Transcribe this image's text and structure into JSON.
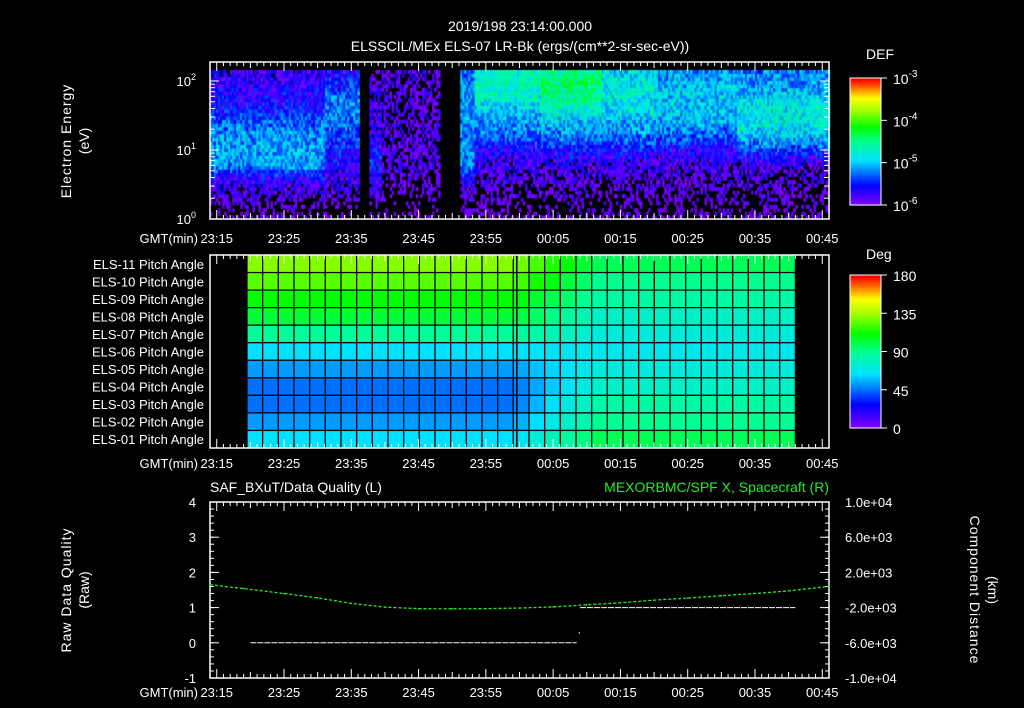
{
  "header": {
    "timestamp": "2019/198 23:14:00.000",
    "title": "ELSSCIL/MEx ELS-07 LR-Bk  (ergs/(cm**2-sr-sec-eV))"
  },
  "colors": {
    "background": "#000000",
    "axis": "#ffffff",
    "green_trace": "#22ee22",
    "quality_trace": "#ffffff"
  },
  "chart_data": [
    {
      "type": "heatmap",
      "name": "electron-spectrogram",
      "title": "ELSSCIL/MEx ELS-07 LR-Bk  (ergs/(cm**2-sr-sec-eV))",
      "ylabel": [
        "Electron Energy",
        "(eV)"
      ],
      "xlabel": "GMT(min)",
      "x_range_min": [
        0,
        92
      ],
      "x_origin": "23:14",
      "x_ticks": [
        "23:15",
        "23:25",
        "23:35",
        "23:45",
        "23:55",
        "00:05",
        "00:15",
        "00:25",
        "00:35",
        "00:45"
      ],
      "y_scale": "log",
      "y_range_log10": [
        0,
        2.275
      ],
      "y_ticks": [
        {
          "b": "10",
          "e": "2"
        },
        {
          "b": "10",
          "e": "1"
        },
        {
          "b": "10",
          "e": "0"
        }
      ],
      "colorbar": {
        "label": "DEF",
        "scale": "log",
        "range_log10": [
          -6,
          -3
        ],
        "ticks": [
          {
            "b": "10",
            "e": "-3"
          },
          {
            "b": "10",
            "e": "-4"
          },
          {
            "b": "10",
            "e": "-5"
          },
          {
            "b": "10",
            "e": "-6"
          }
        ]
      },
      "energy_bins_eV": [
        1.5,
        2.5,
        4,
        6,
        10,
        16,
        25,
        40,
        63,
        100,
        140
      ],
      "segments_log10_def": [
        {
          "t": [
            0,
            17
          ],
          "v": [
            -6.2,
            -5.9,
            -5.6,
            -5.0,
            -4.9,
            -5.0,
            -5.2,
            -5.5,
            -5.6,
            -5.7,
            -5.8
          ]
        },
        {
          "t": [
            17,
            22
          ],
          "v": [
            -6.3,
            -6.0,
            -5.8,
            -5.6,
            -5.5,
            -5.3,
            -5.1,
            -5.0,
            -5.1,
            -5.4,
            -5.6
          ]
        },
        {
          "t": [
            22,
            23.5
          ],
          "v": [
            -6.6,
            -6.6,
            -6.6,
            -6.6,
            -6.6,
            -6.6,
            -6.6,
            -6.6,
            -6.6,
            -6.6,
            -6.6
          ]
        },
        {
          "t": [
            23.5,
            25.5
          ],
          "v": [
            -6.2,
            -5.9,
            -5.7,
            -5.4,
            -5.6,
            -5.8,
            -5.8,
            -5.9,
            -5.9,
            -6.0,
            -6.0
          ]
        },
        {
          "t": [
            25.5,
            34
          ],
          "v": [
            -6.3,
            -6.2,
            -6.1,
            -6.0,
            -6.0,
            -6.0,
            -6.0,
            -6.0,
            -6.0,
            -6.0,
            -6.0
          ]
        },
        {
          "t": [
            34,
            37
          ],
          "v": [
            -6.6,
            -6.6,
            -6.6,
            -6.6,
            -6.6,
            -6.6,
            -6.6,
            -6.6,
            -6.6,
            -6.6,
            -6.6
          ]
        },
        {
          "t": [
            37,
            39
          ],
          "v": [
            -6.2,
            -6.0,
            -5.5,
            -5.0,
            -5.0,
            -5.1,
            -5.1,
            -5.0,
            -5.0,
            -5.1,
            -5.2
          ]
        },
        {
          "t": [
            39,
            49
          ],
          "v": [
            -6.2,
            -6.1,
            -5.9,
            -5.8,
            -5.6,
            -5.2,
            -5.0,
            -4.8,
            -4.5,
            -4.4,
            -4.5
          ]
        },
        {
          "t": [
            49,
            58
          ],
          "v": [
            -6.2,
            -6.1,
            -6.0,
            -5.8,
            -5.5,
            -5.1,
            -4.8,
            -4.5,
            -4.2,
            -4.1,
            -4.3
          ]
        },
        {
          "t": [
            58,
            66
          ],
          "v": [
            -6.2,
            -6.1,
            -6.0,
            -5.8,
            -5.5,
            -5.1,
            -4.9,
            -4.7,
            -4.6,
            -4.6,
            -4.8
          ]
        },
        {
          "t": [
            66,
            78
          ],
          "v": [
            -6.2,
            -6.1,
            -6.0,
            -5.8,
            -5.6,
            -5.2,
            -4.9,
            -4.8,
            -4.8,
            -4.9,
            -5.0
          ]
        },
        {
          "t": [
            78,
            92
          ],
          "v": [
            -6.2,
            -6.1,
            -6.0,
            -5.9,
            -5.3,
            -4.8,
            -4.6,
            -4.6,
            -4.8,
            -5.0,
            -5.1
          ]
        }
      ]
    },
    {
      "type": "heatmap",
      "name": "pitch-angle",
      "xlabel": "GMT(min)",
      "x_ticks": [
        "23:15",
        "23:25",
        "23:35",
        "23:45",
        "23:55",
        "00:05",
        "00:15",
        "00:25",
        "00:35",
        "00:45"
      ],
      "rows": [
        "ELS-11 Pitch Angle",
        "ELS-10 Pitch Angle",
        "ELS-09 Pitch Angle",
        "ELS-08 Pitch Angle",
        "ELS-07 Pitch Angle",
        "ELS-06 Pitch Angle",
        "ELS-05 Pitch Angle",
        "ELS-04 Pitch Angle",
        "ELS-03 Pitch Angle",
        "ELS-02 Pitch Angle",
        "ELS-01 Pitch Angle"
      ],
      "data_range_min": [
        5.5,
        87
      ],
      "columns": 35,
      "early_deg": [
        131,
        124,
        112,
        103,
        88,
        63,
        52,
        45,
        45,
        52,
        63
      ],
      "late_deg": [
        99,
        90,
        85,
        77,
        72,
        68,
        72,
        77,
        85,
        90,
        99
      ],
      "transition_min": [
        45,
        58
      ],
      "marker_min": 45.6,
      "colorbar": {
        "label": "Deg",
        "range": [
          0,
          180
        ],
        "ticks": [
          "180",
          "135",
          "90",
          "45",
          "0"
        ]
      }
    },
    {
      "type": "line",
      "name": "data-quality-and-position",
      "title_left": "SAF_BXuT/Data Quality (L)",
      "title_right": "MEXORBMC/SPF X, Spacecraft (R)",
      "ylabel_left": [
        "Raw Data Quality",
        "(Raw)"
      ],
      "ylabel_right": [
        "Component Distance",
        "(km)"
      ],
      "xlabel": "GMT(min)",
      "x_ticks": [
        "23:15",
        "23:25",
        "23:35",
        "23:45",
        "23:55",
        "00:05",
        "00:15",
        "00:25",
        "00:35",
        "00:45"
      ],
      "ylim_left": [
        -1,
        4
      ],
      "yticks_left": [
        "4",
        "3",
        "2",
        "1",
        "0",
        "-1"
      ],
      "ylim_right": [
        -10000,
        10000
      ],
      "yticks_right": [
        "1.0e+04",
        "6.0e+03",
        "2.0e+03",
        "-2.0e+03",
        "-6.0e+03",
        "-1.0e+04"
      ],
      "series": [
        {
          "name": "Data Quality",
          "axis": "left",
          "segments": [
            {
              "t": [
                6,
                54.5
              ],
              "y": 0
            },
            {
              "t": [
                55,
                87
              ],
              "y": 1
            }
          ],
          "points": [
            {
              "t": 54.8,
              "y": 0.3
            }
          ]
        },
        {
          "name": "SPF X",
          "axis": "right",
          "t": [
            0,
            5,
            11,
            16,
            21,
            26,
            31,
            36,
            41,
            46,
            51,
            56,
            61,
            66,
            71,
            76,
            81,
            86,
            92
          ],
          "y": [
            600,
            160,
            -400,
            -900,
            -1520,
            -1950,
            -2120,
            -2140,
            -2120,
            -2050,
            -1920,
            -1680,
            -1450,
            -1150,
            -920,
            -650,
            -400,
            -100,
            400
          ]
        }
      ]
    }
  ]
}
